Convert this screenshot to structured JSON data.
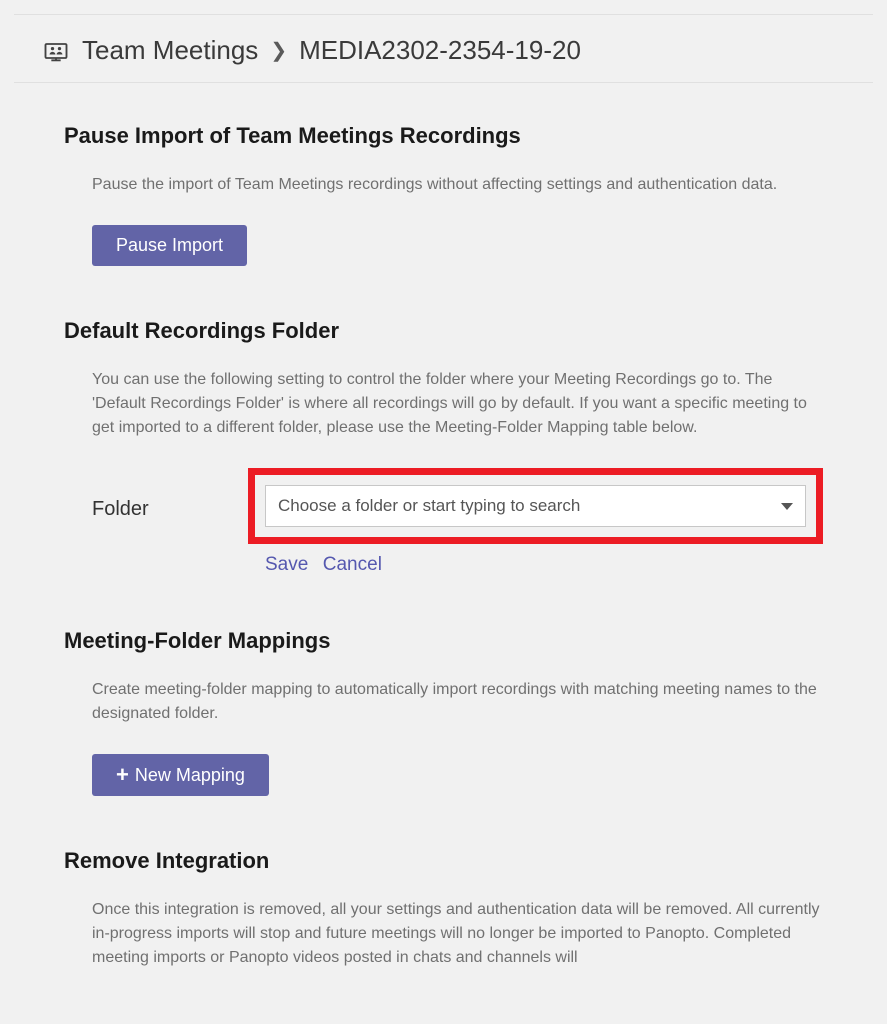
{
  "breadcrumb": {
    "root": "Team Meetings",
    "current": "MEDIA2302-2354-19-20"
  },
  "pause_section": {
    "title": "Pause Import of Team Meetings Recordings",
    "desc": "Pause the import of Team Meetings recordings without affecting settings and authentication data.",
    "button": "Pause Import"
  },
  "folder_section": {
    "title": "Default Recordings Folder",
    "desc": "You can use the following setting to control the folder where your Meeting Recordings go to. The 'Default Recordings Folder' is where all recordings will go by default. If you want a specific meeting to get imported to a different folder, please use the Meeting-Folder Mapping table below.",
    "label": "Folder",
    "placeholder": "Choose a folder or start typing to search",
    "save": "Save",
    "cancel": "Cancel"
  },
  "mapping_section": {
    "title": "Meeting-Folder Mappings",
    "desc": "Create meeting-folder mapping to automatically import recordings with matching meeting names to the designated folder.",
    "button": "New Mapping"
  },
  "remove_section": {
    "title": "Remove Integration",
    "desc": "Once this integration is removed, all your settings and authentication data will be removed. All currently in-progress imports will stop and future meetings will no longer be imported to Panopto. Completed meeting imports or Panopto videos posted in chats and channels will"
  }
}
